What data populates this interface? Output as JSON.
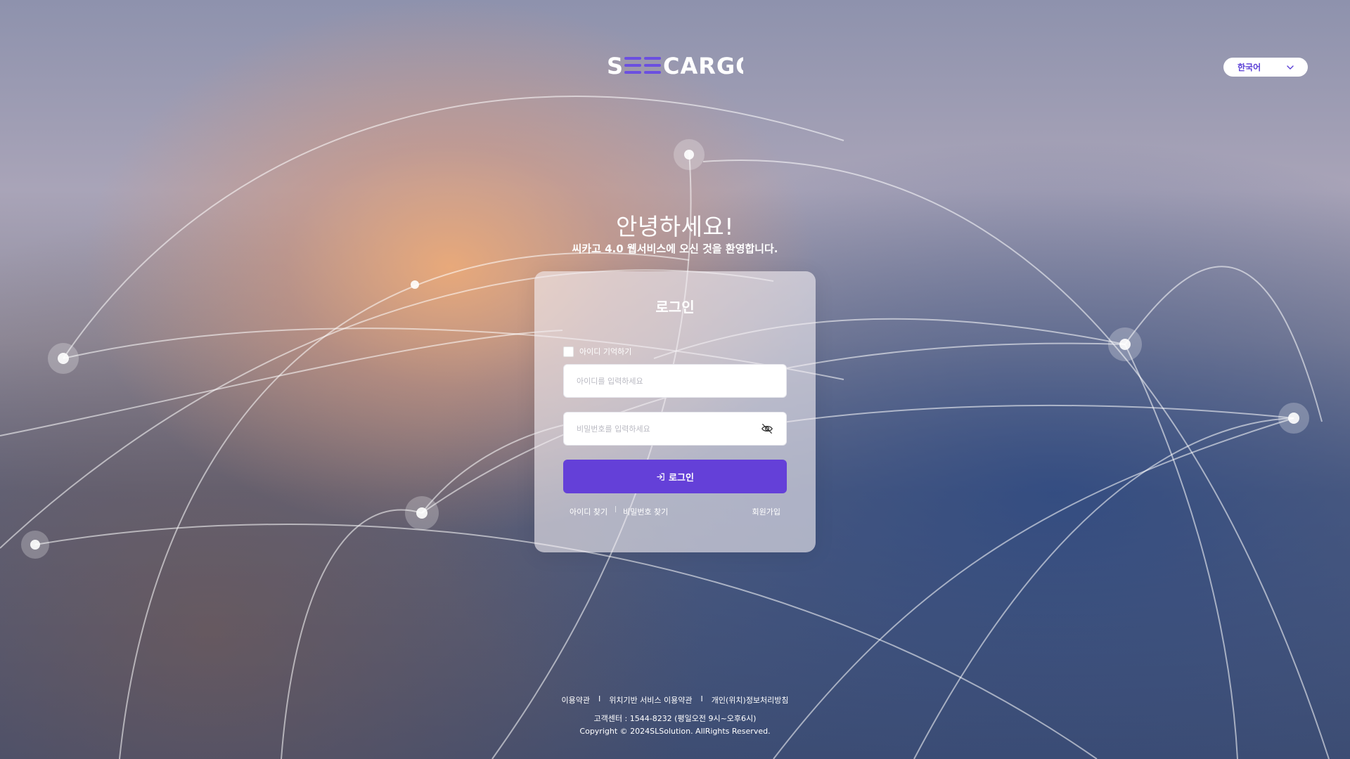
{
  "header": {
    "logo_text": "SEECARGO",
    "language_select": {
      "selected": "한국어"
    }
  },
  "hero": {
    "title": "안녕하세요!",
    "subtitle": "씨카고 4.0 웹서비스에 오신 것을 환영합니다."
  },
  "login_card": {
    "title": "로그인",
    "remember_id_label": "아이디 기억하기",
    "remember_id_checked": false,
    "id_field": {
      "value": "",
      "placeholder": "아이디를 입력하세요"
    },
    "password_field": {
      "value": "",
      "placeholder": "비밀번호를 입력하세요"
    },
    "login_button_label": "로그인",
    "find_id_label": "아이디 찾기",
    "link_separator": "|",
    "find_password_label": "비밀번호 찾기",
    "signup_label": "회원가입"
  },
  "footer": {
    "terms_label": "이용약관",
    "separator": "I",
    "location_terms_label": "위치기반 서비스 이용약관",
    "privacy_label": "개인(위치)정보처리방침",
    "customer_center": "고객센터 : 1544-8232 (평일오전 9시~오후6시)",
    "copyright": "Copyright  © 2024SLSolution. AllRights Reserved."
  },
  "colors": {
    "accent": "#6440d8",
    "logo_purple": "#6b4fe0",
    "card_bg": "rgba(240,236,240,0.62)"
  },
  "icons": {
    "language_dropdown": "chevron-down-icon",
    "password_toggle": "eye-off-icon",
    "login_button": "login-arrow-icon"
  }
}
